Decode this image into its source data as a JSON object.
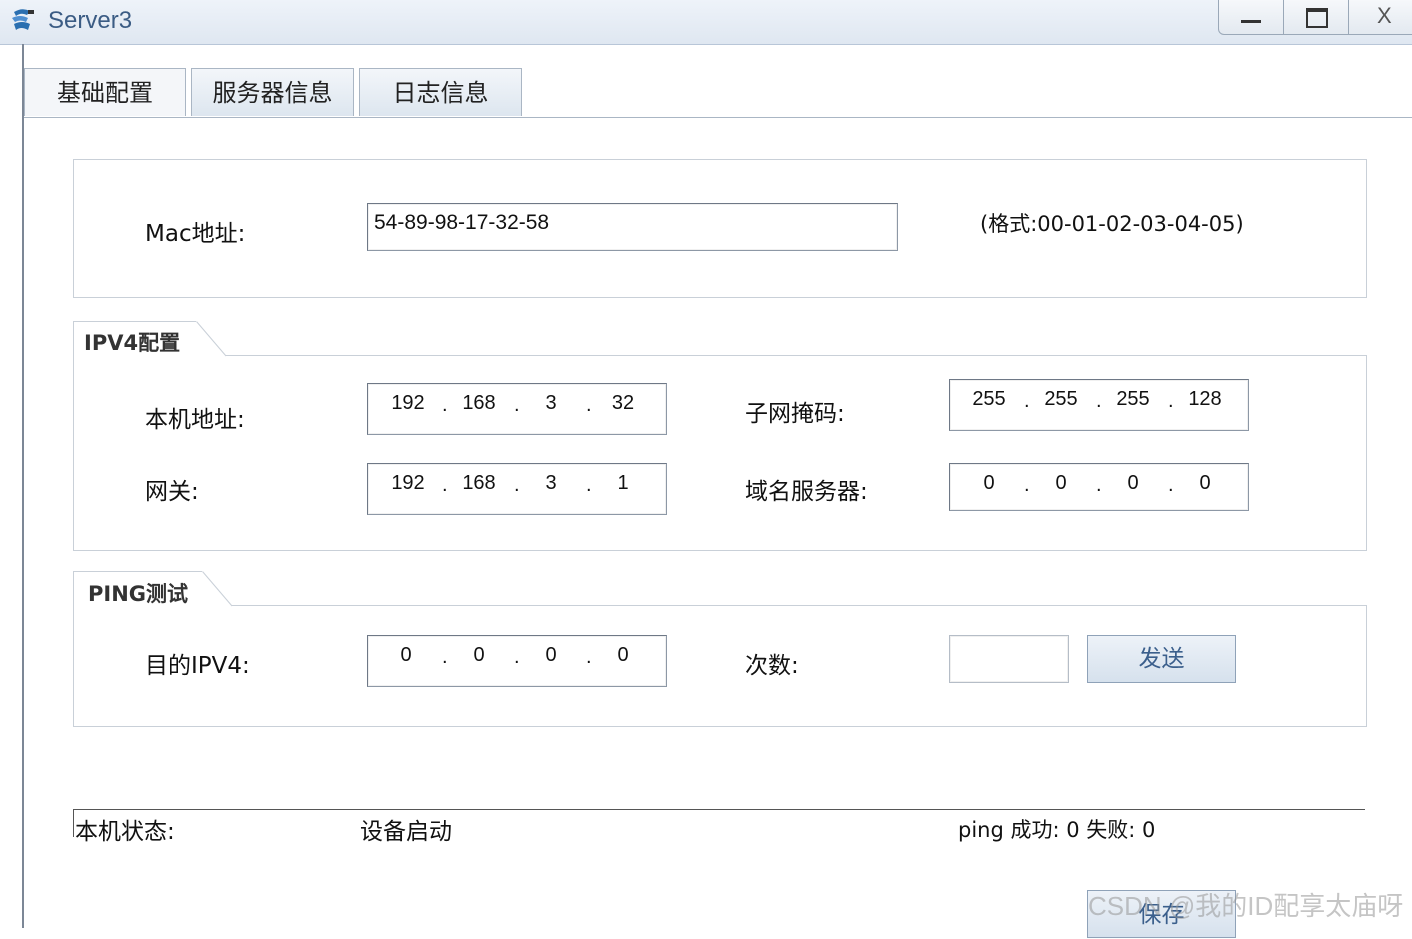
{
  "window": {
    "title": "Server3"
  },
  "tabs": [
    {
      "label": "基础配置"
    },
    {
      "label": "服务器信息"
    },
    {
      "label": "日志信息"
    }
  ],
  "mac_section": {
    "label": "Mac地址:",
    "value": "54-89-98-17-32-58",
    "format_hint": "(格式:00-01-02-03-04-05)"
  },
  "ipv4_section": {
    "title": "IPV4配置",
    "local_address_label": "本机地址:",
    "local_address": [
      "192",
      "168",
      "3",
      "32"
    ],
    "subnet_mask_label": "子网掩码:",
    "subnet_mask": [
      "255",
      "255",
      "255",
      "128"
    ],
    "gateway_label": "网关:",
    "gateway": [
      "192",
      "168",
      "3",
      "1"
    ],
    "dns_label": "域名服务器:",
    "dns": [
      "0",
      "0",
      "0",
      "0"
    ]
  },
  "ping_section": {
    "title": "PING测试",
    "target_label": "目的IPV4:",
    "target": [
      "0",
      "0",
      "0",
      "0"
    ],
    "count_label": "次数:",
    "count_value": "",
    "send_label": "发送"
  },
  "status": {
    "label": "本机状态:",
    "value": "设备启动",
    "ping_result": "ping 成功: 0 失败: 0"
  },
  "save_label": "保存",
  "watermark": "CSDN @我的ID配享太庙呀",
  "colors": {
    "title_text": "#3b5c84",
    "button_text": "#3b5f8c",
    "border": "#c9d0d8"
  }
}
